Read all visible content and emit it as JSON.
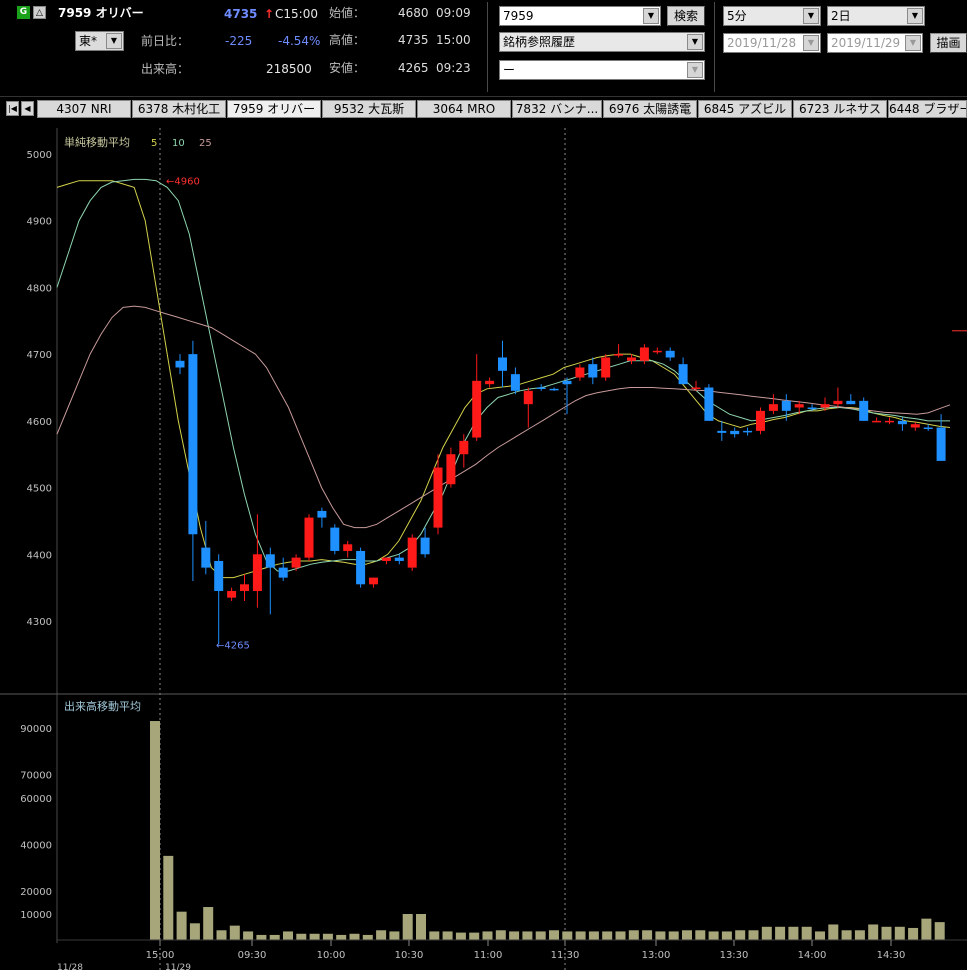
{
  "header": {
    "stock_label": "7959 オリバー",
    "price": "4735",
    "price_arrow": "↑",
    "price_time": "C15:00",
    "market": "東*",
    "change_label": "前日比：",
    "change_value": "-225",
    "change_pct": "-4.54%",
    "volume_label": "出来高：",
    "volume_value": "218500",
    "open_label": "始値：",
    "open_value": "4680",
    "open_time": "09:09",
    "high_label": "高値：",
    "high_value": "4735",
    "high_time": "15:00",
    "low_label": "安値：",
    "low_value": "4265",
    "low_time": "09:23",
    "code_input": "7959",
    "search_button": "検索",
    "history_select": "銘柄参照履歴",
    "third_select": "ー",
    "interval_select": "5分",
    "period_select": "2日",
    "date_from": "2019/11/28",
    "date_to": "2019/11/29",
    "draw_button": "描画"
  },
  "tabs": [
    "4307 NRI",
    "6378 木村化工",
    "7959 オリバー",
    "9532 大瓦斯",
    "3064 MRO",
    "7832 バンナ...",
    "6976 太陽誘電",
    "6845 アズビル",
    "6723 ルネサス",
    "6448 ブラザー"
  ],
  "colors": {
    "up": "#ff1a1a",
    "down": "#1e90ff",
    "ma5": "#d4d24a",
    "ma10": "#8ed6b0",
    "ma25": "#c89a9a",
    "volume": "#a6a67a",
    "neg": "#6f8cff"
  },
  "chart_data": [
    {
      "type": "candlestick",
      "title": "単純移動平均",
      "legend": [
        "5",
        "10",
        "25"
      ],
      "ylim": [
        4200,
        5000
      ],
      "yticks": [
        4300,
        4400,
        4500,
        4600,
        4700,
        4800,
        4900,
        5000
      ],
      "annotations": [
        {
          "text": "4960",
          "x": "15:00",
          "value": 4960
        },
        {
          "text": "4265",
          "x": "09:23",
          "value": 4265
        }
      ],
      "candles": [
        {
          "o": 4690,
          "h": 4700,
          "l": 4670,
          "c": 4680
        },
        {
          "o": 4700,
          "h": 4720,
          "l": 4360,
          "c": 4430
        },
        {
          "o": 4410,
          "h": 4450,
          "l": 4370,
          "c": 4380
        },
        {
          "o": 4390,
          "h": 4400,
          "l": 4265,
          "c": 4345
        },
        {
          "o": 4335,
          "h": 4350,
          "l": 4330,
          "c": 4345
        },
        {
          "o": 4345,
          "h": 4370,
          "l": 4330,
          "c": 4355
        },
        {
          "o": 4345,
          "h": 4460,
          "l": 4320,
          "c": 4400
        },
        {
          "o": 4400,
          "h": 4410,
          "l": 4310,
          "c": 4380
        },
        {
          "o": 4380,
          "h": 4395,
          "l": 4360,
          "c": 4365
        },
        {
          "o": 4380,
          "h": 4400,
          "l": 4375,
          "c": 4395
        },
        {
          "o": 4395,
          "h": 4460,
          "l": 4390,
          "c": 4455
        },
        {
          "o": 4465,
          "h": 4470,
          "l": 4440,
          "c": 4455
        },
        {
          "o": 4440,
          "h": 4445,
          "l": 4400,
          "c": 4405
        },
        {
          "o": 4405,
          "h": 4420,
          "l": 4395,
          "c": 4415
        },
        {
          "o": 4405,
          "h": 4410,
          "l": 4350,
          "c": 4355
        },
        {
          "o": 4355,
          "h": 4365,
          "l": 4350,
          "c": 4365
        },
        {
          "o": 4390,
          "h": 4395,
          "l": 4385,
          "c": 4395
        },
        {
          "o": 4395,
          "h": 4400,
          "l": 4385,
          "c": 4390
        },
        {
          "o": 4380,
          "h": 4430,
          "l": 4375,
          "c": 4425
        },
        {
          "o": 4425,
          "h": 4440,
          "l": 4395,
          "c": 4400
        },
        {
          "o": 4440,
          "h": 4550,
          "l": 4430,
          "c": 4530
        },
        {
          "o": 4505,
          "h": 4560,
          "l": 4500,
          "c": 4550
        },
        {
          "o": 4550,
          "h": 4580,
          "l": 4530,
          "c": 4570
        },
        {
          "o": 4575,
          "h": 4700,
          "l": 4570,
          "c": 4660
        },
        {
          "o": 4655,
          "h": 4665,
          "l": 4650,
          "c": 4660
        },
        {
          "o": 4695,
          "h": 4720,
          "l": 4650,
          "c": 4675
        },
        {
          "o": 4670,
          "h": 4680,
          "l": 4640,
          "c": 4645
        },
        {
          "o": 4625,
          "h": 4650,
          "l": 4590,
          "c": 4645
        },
        {
          "o": 4650,
          "h": 4655,
          "l": 4645,
          "c": 4648
        },
        {
          "o": 4648,
          "h": 4650,
          "l": 4645,
          "c": 4646
        },
        {
          "o": 4660,
          "h": 4665,
          "l": 4610,
          "c": 4655
        },
        {
          "o": 4665,
          "h": 4685,
          "l": 4660,
          "c": 4680
        },
        {
          "o": 4685,
          "h": 4695,
          "l": 4655,
          "c": 4665
        },
        {
          "o": 4665,
          "h": 4700,
          "l": 4660,
          "c": 4695
        },
        {
          "o": 4700,
          "h": 4715,
          "l": 4695,
          "c": 4700
        },
        {
          "o": 4690,
          "h": 4700,
          "l": 4685,
          "c": 4695
        },
        {
          "o": 4690,
          "h": 4715,
          "l": 4685,
          "c": 4710
        },
        {
          "o": 4705,
          "h": 4710,
          "l": 4700,
          "c": 4705
        },
        {
          "o": 4705,
          "h": 4710,
          "l": 4690,
          "c": 4695
        },
        {
          "o": 4685,
          "h": 4695,
          "l": 4655,
          "c": 4655
        },
        {
          "o": 4650,
          "h": 4660,
          "l": 4645,
          "c": 4650
        },
        {
          "o": 4650,
          "h": 4655,
          "l": 4600,
          "c": 4600
        },
        {
          "o": 4585,
          "h": 4600,
          "l": 4570,
          "c": 4582
        },
        {
          "o": 4585,
          "h": 4590,
          "l": 4575,
          "c": 4580
        },
        {
          "o": 4585,
          "h": 4590,
          "l": 4578,
          "c": 4583
        },
        {
          "o": 4585,
          "h": 4620,
          "l": 4580,
          "c": 4615
        },
        {
          "o": 4615,
          "h": 4640,
          "l": 4610,
          "c": 4625
        },
        {
          "o": 4630,
          "h": 4640,
          "l": 4600,
          "c": 4615
        },
        {
          "o": 4620,
          "h": 4630,
          "l": 4610,
          "c": 4625
        },
        {
          "o": 4620,
          "h": 4625,
          "l": 4615,
          "c": 4618
        },
        {
          "o": 4620,
          "h": 4635,
          "l": 4615,
          "c": 4625
        },
        {
          "o": 4625,
          "h": 4650,
          "l": 4620,
          "c": 4630
        },
        {
          "o": 4630,
          "h": 4640,
          "l": 4625,
          "c": 4625
        },
        {
          "o": 4630,
          "h": 4635,
          "l": 4600,
          "c": 4600
        },
        {
          "o": 4600,
          "h": 4605,
          "l": 4598,
          "c": 4600
        },
        {
          "o": 4600,
          "h": 4605,
          "l": 4595,
          "c": 4600
        },
        {
          "o": 4600,
          "h": 4605,
          "l": 4585,
          "c": 4595
        },
        {
          "o": 4590,
          "h": 4598,
          "l": 4585,
          "c": 4595
        },
        {
          "o": 4590,
          "h": 4595,
          "l": 4585,
          "c": 4588
        },
        {
          "o": 4590,
          "h": 4610,
          "l": 4540,
          "c": 4540
        }
      ],
      "ma_series": [
        {
          "name": "5",
          "values": [
            4950,
            4955,
            4960,
            4960,
            4960,
            4960,
            4955,
            4950,
            4900,
            4800,
            4700,
            4600,
            4520,
            4440,
            4380,
            4365,
            4365,
            4370,
            4375,
            4380,
            4385,
            4388,
            4390,
            4390,
            4392,
            4390,
            4388,
            4385,
            4385,
            4390,
            4400,
            4420,
            4450,
            4480,
            4520,
            4560,
            4590,
            4620,
            4640,
            4648,
            4650,
            4652,
            4655,
            4660,
            4665,
            4670,
            4680,
            4685,
            4690,
            4695,
            4698,
            4700,
            4700,
            4695,
            4690,
            4680,
            4670,
            4650,
            4630,
            4610,
            4600,
            4595,
            4590,
            4595,
            4598,
            4602,
            4605,
            4610,
            4615,
            4615,
            4618,
            4620,
            4620,
            4618,
            4612,
            4608,
            4605,
            4600,
            4598,
            4595,
            4592,
            4590
          ]
        },
        {
          "name": "10",
          "values": [
            4800,
            4850,
            4900,
            4930,
            4950,
            4958,
            4960,
            4962,
            4962,
            4960,
            4950,
            4930,
            4880,
            4800,
            4720,
            4640,
            4560,
            4490,
            4430,
            4390,
            4375,
            4375,
            4380,
            4385,
            4388,
            4390,
            4392,
            4392,
            4390,
            4390,
            4395,
            4400,
            4410,
            4430,
            4460,
            4490,
            4530,
            4570,
            4600,
            4620,
            4635,
            4640,
            4645,
            4648,
            4650,
            4655,
            4660,
            4665,
            4670,
            4675,
            4680,
            4685,
            4690,
            4690,
            4690,
            4685,
            4675,
            4660,
            4645,
            4630,
            4620,
            4610,
            4605,
            4600,
            4602,
            4605,
            4608,
            4612,
            4615,
            4618,
            4620,
            4620,
            4618,
            4615,
            4612,
            4610,
            4608,
            4605,
            4603,
            4600,
            4600,
            4600
          ]
        },
        {
          "name": "25",
          "values": [
            4580,
            4620,
            4660,
            4700,
            4730,
            4755,
            4770,
            4772,
            4770,
            4765,
            4760,
            4755,
            4750,
            4745,
            4740,
            4730,
            4720,
            4710,
            4700,
            4680,
            4650,
            4620,
            4580,
            4540,
            4500,
            4470,
            4445,
            4440,
            4440,
            4445,
            4455,
            4465,
            4475,
            4485,
            4495,
            4505,
            4515,
            4525,
            4535,
            4548,
            4560,
            4570,
            4580,
            4590,
            4600,
            4610,
            4620,
            4630,
            4638,
            4642,
            4645,
            4648,
            4650,
            4650,
            4650,
            4649,
            4648,
            4647,
            4646,
            4645,
            4643,
            4641,
            4639,
            4637,
            4635,
            4633,
            4631,
            4629,
            4627,
            4625,
            4623,
            4621,
            4619,
            4617,
            4615,
            4613,
            4612,
            4611,
            4610,
            4612,
            4618,
            4624
          ]
        }
      ],
      "marker_right": 4735
    },
    {
      "type": "bar",
      "title": "出来高移動平均",
      "ylim": [
        0,
        100000
      ],
      "yticks": [
        10000,
        20000,
        40000,
        60000,
        70000,
        90000
      ],
      "x_ticks": [
        "15:00",
        "09:30",
        "10:00",
        "10:30",
        "11:00",
        "11:30",
        "13:00",
        "13:30",
        "14:00",
        "14:30"
      ],
      "date_labels": [
        "11/28",
        "11/29"
      ],
      "values": [
        93000,
        35000,
        11000,
        6000,
        13000,
        3000,
        5000,
        2500,
        1000,
        1000,
        2500,
        1500,
        1500,
        1500,
        1000,
        1500,
        1000,
        3000,
        2500,
        10000,
        10000,
        2500,
        2500,
        2000,
        2000,
        2500,
        3000,
        2500,
        2500,
        2500,
        3000,
        2500,
        2500,
        2500,
        2500,
        2500,
        3000,
        3000,
        2500,
        2500,
        3000,
        3000,
        2500,
        2500,
        3000,
        3000,
        4500,
        4500,
        4500,
        4500,
        2500,
        5500,
        3000,
        3000,
        5500,
        4500,
        4500,
        4000,
        8000,
        6500
      ]
    }
  ]
}
